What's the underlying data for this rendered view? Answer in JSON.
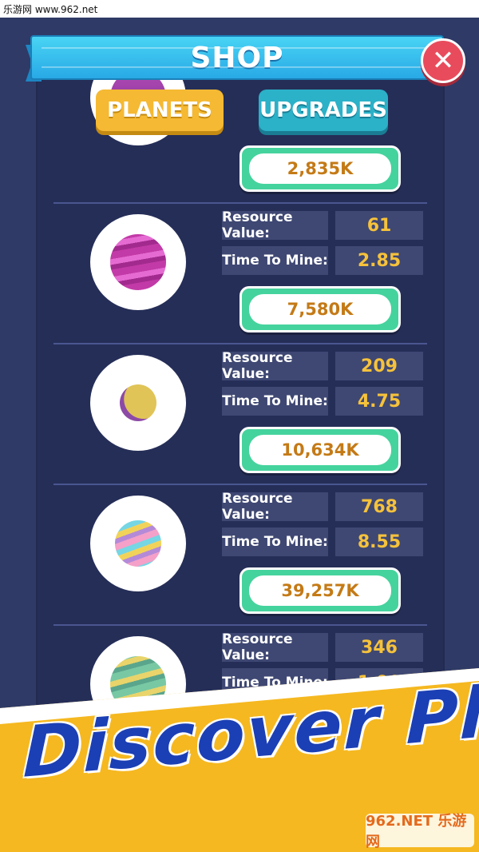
{
  "watermark_top": "乐游网 www.962.net",
  "watermark_bottom": "962.NET 乐游网",
  "shop": {
    "title": "SHOP"
  },
  "tabs": {
    "planets": "PLANETS",
    "upgrades": "UPGRADES",
    "active": "PLANETS"
  },
  "labels": {
    "resource_value": "Resource Value:",
    "time_to_mine": "Time To Mine:"
  },
  "currency_icon": "₵",
  "planets": [
    {
      "price": "2,835K",
      "colors": [
        "#b24bb8",
        "#ffffff"
      ]
    },
    {
      "resource_value": "61",
      "time_to_mine": "2.85",
      "price": "7,580K",
      "colors": [
        "#c040a8",
        "#e36ad0"
      ]
    },
    {
      "resource_value": "209",
      "time_to_mine": "4.75",
      "price": "10,634K",
      "colors": [
        "#8e4aa8",
        "#d9b84a"
      ]
    },
    {
      "resource_value": "768",
      "time_to_mine": "8.55",
      "price": "39,257K",
      "colors": [
        "#f4a0c8",
        "#76d6e4",
        "#f2d35a"
      ]
    },
    {
      "resource_value": "346",
      "time_to_mine": "1.90",
      "price": "",
      "colors": [
        "#78c8a4",
        "#e8d46a"
      ]
    }
  ],
  "banner": {
    "text": "Discover Planets !"
  },
  "colors": {
    "panel": "#252e57",
    "accent_blue": "#28a9e6",
    "gold": "#f6c23b",
    "green": "#45d39d",
    "banner": "#f5b820",
    "banner_text": "#1b3fb5"
  }
}
